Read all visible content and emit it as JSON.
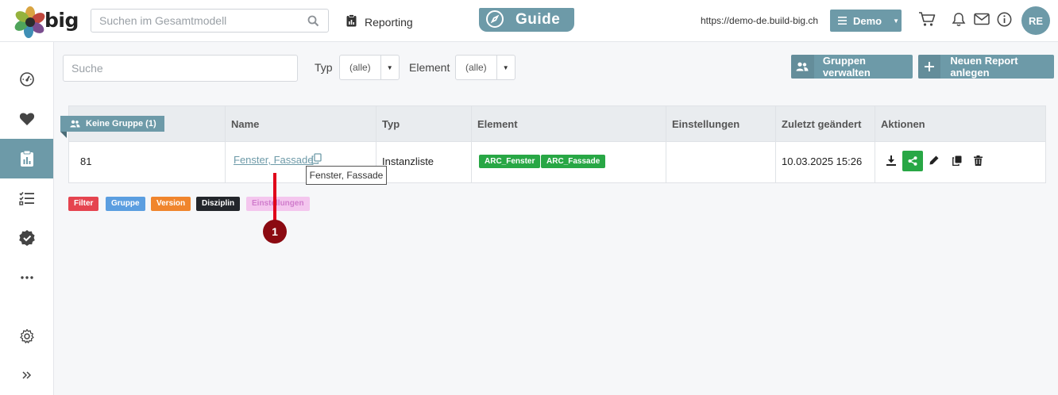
{
  "header": {
    "logo_text": "big",
    "global_search_placeholder": "Suchen im Gesamtmodell",
    "reporting_label": "Reporting",
    "guide_label": "Guide",
    "url": "https://demo-de.build-big.ch",
    "project_label": "Demo",
    "avatar_initials": "RE"
  },
  "toolbar": {
    "search_placeholder": "Suche",
    "type_label": "Typ",
    "type_value": "(alle)",
    "element_label": "Element",
    "element_value": "(alle)",
    "groups_button": "Gruppen verwalten",
    "new_report_button": "Neuen Report anlegen"
  },
  "table": {
    "group_badge": "Keine Gruppe (1)",
    "columns": [
      "Name",
      "Typ",
      "Element",
      "Einstellungen",
      "Zuletzt geändert",
      "Aktionen"
    ],
    "rows": [
      {
        "id": "81",
        "name": "Fenster, Fassade",
        "type": "Instanzliste",
        "elements": [
          "ARC_Fenster",
          "ARC_Fassade"
        ],
        "settings": "",
        "modified": "10.03.2025 15:26"
      }
    ],
    "tooltip": "Fenster, Fassade"
  },
  "legend": [
    {
      "label": "Filter",
      "color": "#e5444f"
    },
    {
      "label": "Gruppe",
      "color": "#5b9ee0"
    },
    {
      "label": "Version",
      "color": "#f0852d"
    },
    {
      "label": "Disziplin",
      "color": "#23262b"
    },
    {
      "label": "Einstellungen",
      "color": "#f4c6ee"
    }
  ],
  "annotation": {
    "number": "1"
  },
  "colors": {
    "accent": "#6d9aa8",
    "success": "#28a745",
    "annotation": "#8b0a12"
  }
}
